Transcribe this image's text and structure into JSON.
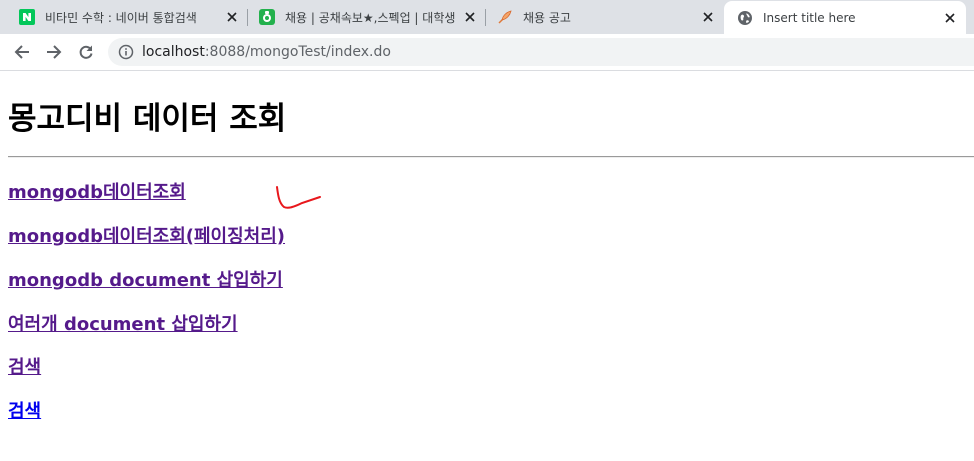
{
  "browser": {
    "tabs": [
      {
        "title": "비타민 수학 : 네이버 통합검색",
        "favicon": "naver-icon"
      },
      {
        "title": "채용 | 공채속보★,스펙업 | 대학생",
        "favicon": "spec-up-icon"
      },
      {
        "title": "채용 공고",
        "favicon": "feather-icon"
      },
      {
        "title": "Insert title here",
        "favicon": "globe-icon"
      }
    ],
    "url": {
      "host": "localhost",
      "rest": ":8088/mongoTest/index.do"
    }
  },
  "page": {
    "heading": "몽고디비 데이터 조회",
    "links": [
      {
        "label": "mongodb데이터조회",
        "state": "visited"
      },
      {
        "label": "mongodb데이터조회(페이징처리)",
        "state": "visited"
      },
      {
        "label": "mongodb document 삽입하기",
        "state": "visited"
      },
      {
        "label": "여러개 document 삽입하기",
        "state": "visited"
      },
      {
        "label": "검색",
        "state": "visited"
      },
      {
        "label": "검색",
        "state": "unvisited"
      }
    ]
  },
  "colors": {
    "visited_link": "#551a8b",
    "unvisited_link": "#0000ee",
    "annotation": "#e8171c",
    "naver_green": "#03c75a"
  }
}
